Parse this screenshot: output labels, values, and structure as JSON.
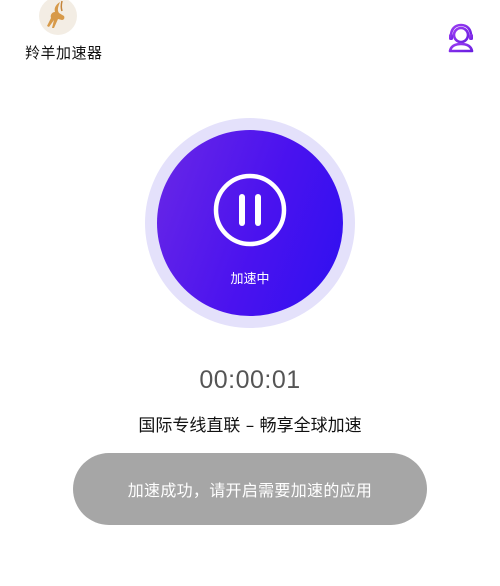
{
  "header": {
    "app_name": "羚羊加速器",
    "logo_icon": "antelope-logo-icon",
    "support_icon": "customer-service-icon"
  },
  "accelerator": {
    "status": "加速中",
    "control_icon": "pause-icon",
    "gradient_start": "#6a28e6",
    "gradient_end": "#2e10f0",
    "halo_color": "#e4e1fb"
  },
  "timer": "00:00:01",
  "subtitle": "国际专线直联 – 畅享全球加速",
  "toast": {
    "message": "加速成功，请开启需要加速的应用"
  },
  "colors": {
    "accent": "#7b2ff0"
  }
}
